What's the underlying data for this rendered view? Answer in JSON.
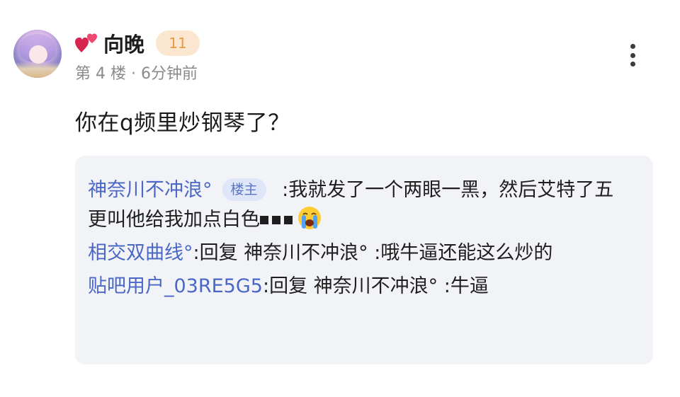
{
  "post": {
    "username": "向晚",
    "level": "11",
    "floor_info": "第 4 楼 · 6分钟前",
    "content": "你在q频里炒钢琴了？"
  },
  "replies": [
    {
      "user": "神奈川不冲浪°",
      "badge": "楼主",
      "text": " :我就发了一个两眼一黑，然后艾特了五更叫他给我加点白色"
    },
    {
      "user": "相交双曲线°",
      "text": ":回复 神奈川不冲浪° :哦牛逼还能这么炒的"
    },
    {
      "user": "贴吧用户_03RE5G5",
      "text": ":回复 神奈川不冲浪° :牛逼"
    }
  ],
  "icons": {
    "heart": "two-hearts-icon",
    "more": "more-vertical-icon",
    "cry": "loudly-crying-face-icon"
  },
  "colors": {
    "link": "#4a67c6",
    "level_badge_bg": "#fbe7cf",
    "level_badge_text": "#e69a4a",
    "reply_bg": "#f1f3f7"
  }
}
